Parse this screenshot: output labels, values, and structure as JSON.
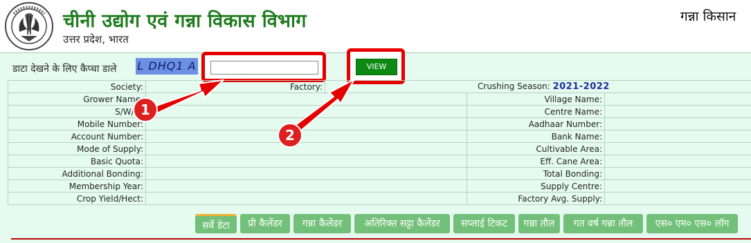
{
  "header": {
    "title": "चीनी उद्योग एवं गन्ना विकास विभाग",
    "subtitle": "उत्तर प्रदेश, भारत",
    "top_right": "गन्ना किसान "
  },
  "form": {
    "prompt": "डाटा देखने के लिए कैप्चा डाले",
    "captcha": "L DHQ1 A",
    "captcha_input_value": "",
    "view_label": "VIEW"
  },
  "info": {
    "society": "Society:",
    "factory": "Factory:",
    "crushing_season_label": "Crushing Season:",
    "crushing_season": "2021-2022",
    "left_labels": [
      "Grower Name:",
      "S/W/O:",
      "Mobile Number:",
      "Account Number:",
      "Mode of Supply:",
      "Basic Quota:",
      "Additional Bonding:",
      "Membership Year:",
      "Crop Yield/Hect:"
    ],
    "right_labels": [
      "Village Name:",
      "Centre Name:",
      "Aadhaar Number:",
      "Bank Name:",
      "Cultivable Area:",
      "Eff. Cane Area:",
      "Total Bonding:",
      "Supply Centre:",
      "Factory Avg. Supply:"
    ]
  },
  "tabs": [
    {
      "label": "सर्वे डेटा"
    },
    {
      "label": "प्री कैलेंडर"
    },
    {
      "label": "गन्ना कैलेंडर"
    },
    {
      "label": "अतिरिक्त सट्टा कैलेंडर"
    },
    {
      "label": "सप्लाई टिकट"
    },
    {
      "label": "गन्ना तौल"
    },
    {
      "label": "गत वर्ष गन्ना तौल"
    },
    {
      "label": "एस० एम० एस० लॉग"
    }
  ],
  "annotations": {
    "badge1": "1",
    "badge2": "2",
    "color": "#e50000"
  }
}
